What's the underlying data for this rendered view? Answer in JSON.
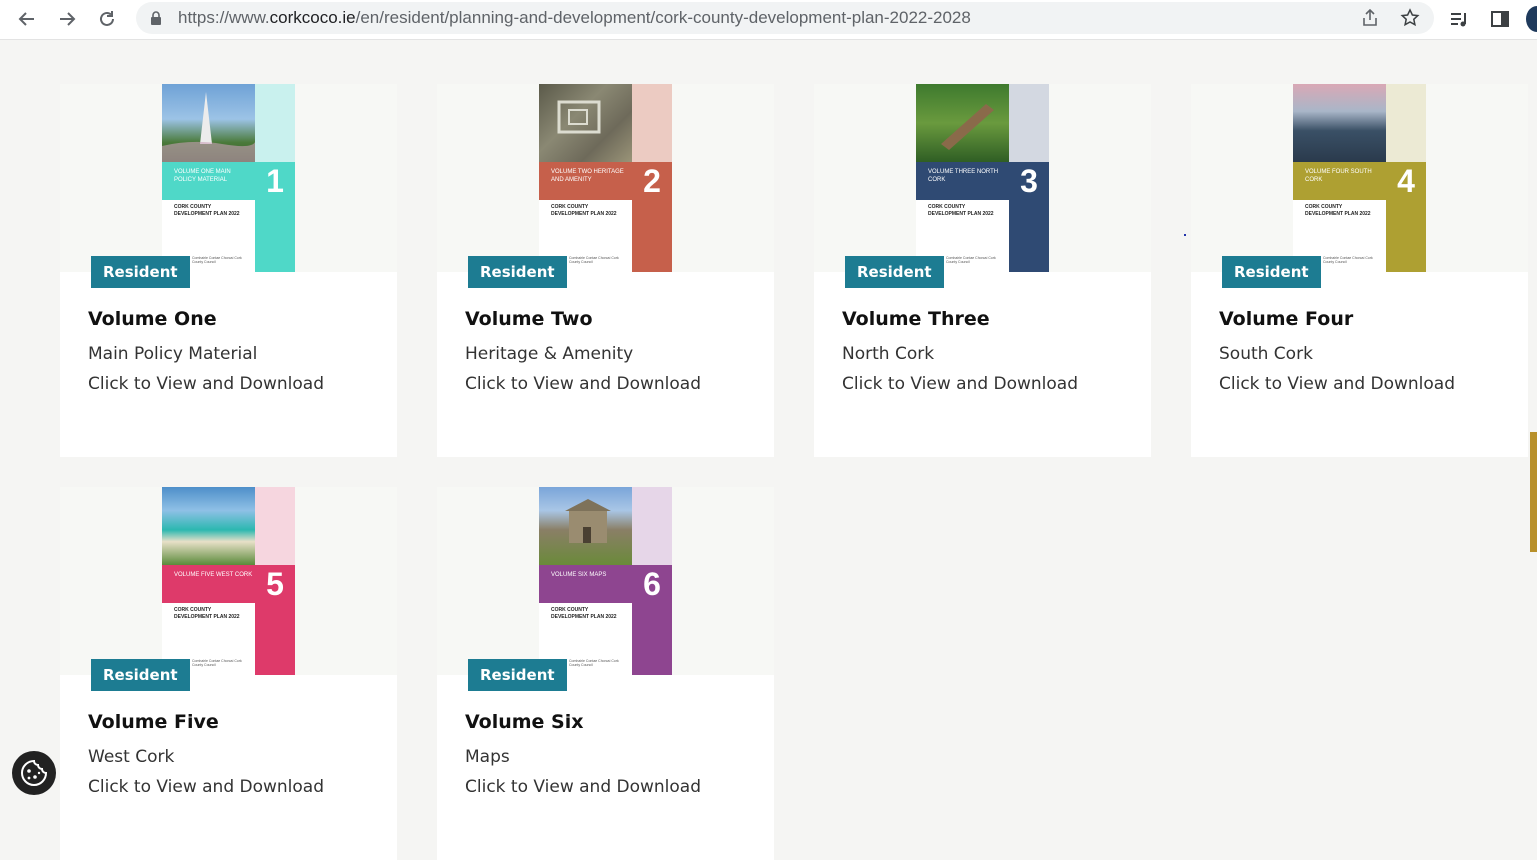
{
  "browser": {
    "url_prefix": "https://www.",
    "url_host": "corkcoco.ie",
    "url_path": "/en/resident/planning-and-development/cork-county-development-plan-2022-2028",
    "icons": [
      "back-arrow-icon",
      "forward-arrow-icon",
      "reload-icon",
      "lock-icon",
      "share-icon",
      "star-icon",
      "reading-list-icon",
      "side-panel-icon",
      "profile-avatar"
    ]
  },
  "cards": [
    {
      "badge": "Resident",
      "title": "Volume One",
      "subtitle": "Main Policy Material",
      "link": "Click to View and Download",
      "cover": {
        "number": "1",
        "band_text": "Volume One Main Policy Material",
        "plan_text": "Cork County Development Plan 2022",
        "logo_text": "Comhairle Contae Chorcaí Cork County Council",
        "band_color": "#4fd8c8",
        "light_color": "#c9f1ee",
        "photo_colors": [
          "#6fa2d6",
          "#4a7a3a"
        ]
      }
    },
    {
      "badge": "Resident",
      "title": "Volume Two",
      "subtitle": "Heritage & Amenity",
      "link": "Click to View and Download",
      "cover": {
        "number": "2",
        "band_text": "Volume Two Heritage and Amenity",
        "plan_text": "Cork County Development Plan 2022",
        "logo_text": "Comhairle Contae Chorcaí Cork County Council",
        "band_color": "#c6604b",
        "light_color": "#eccbc2",
        "photo_colors": [
          "#6e6a5a",
          "#8a8873"
        ]
      }
    },
    {
      "badge": "Resident",
      "title": "Volume Three",
      "subtitle": "North Cork",
      "link": "Click to View and Download",
      "cover": {
        "number": "3",
        "band_text": "Volume Three North Cork",
        "plan_text": "Cork County Development Plan 2022",
        "logo_text": "Comhairle Contae Chorcaí Cork County Council",
        "band_color": "#2f4a73",
        "light_color": "#d3d8e1",
        "photo_colors": [
          "#3e7a2e",
          "#6a9a3e"
        ]
      }
    },
    {
      "badge": "Resident",
      "title": "Volume Four",
      "subtitle": "South Cork",
      "link": "Click to View and Download",
      "cover": {
        "number": "4",
        "band_text": "Volume Four South Cork",
        "plan_text": "Cork County Development Plan 2022",
        "logo_text": "Comhairle Contae Chorcaí Cork County Council",
        "band_color": "#aea032",
        "light_color": "#ecead4",
        "photo_colors": [
          "#d9a8b5",
          "#3a5066"
        ]
      }
    },
    {
      "badge": "Resident",
      "title": "Volume Five",
      "subtitle": "West Cork",
      "link": "Click to View and Download",
      "cover": {
        "number": "5",
        "band_text": "Volume Five West Cork",
        "plan_text": "Cork County Development Plan 2022",
        "logo_text": "Comhairle Contae Chorcaí Cork County Council",
        "band_color": "#de3a6a",
        "light_color": "#f6d6df",
        "photo_colors": [
          "#4e8fc9",
          "#2cb8b0"
        ]
      }
    },
    {
      "badge": "Resident",
      "title": "Volume Six",
      "subtitle": "Maps",
      "link": "Click to View and Download",
      "cover": {
        "number": "6",
        "band_text": "Volume Six Maps",
        "plan_text": "Cork County Development Plan 2022",
        "logo_text": "Comhairle Contae Chorcaí Cork County Council",
        "band_color": "#8e4590",
        "light_color": "#e6d6e8",
        "photo_colors": [
          "#7aa5d9",
          "#8a7f66"
        ]
      }
    }
  ],
  "colors": {
    "badge_bg": "#1d7c92",
    "page_bg": "#f5f5f3",
    "accent_scroll": "#b8902a"
  }
}
